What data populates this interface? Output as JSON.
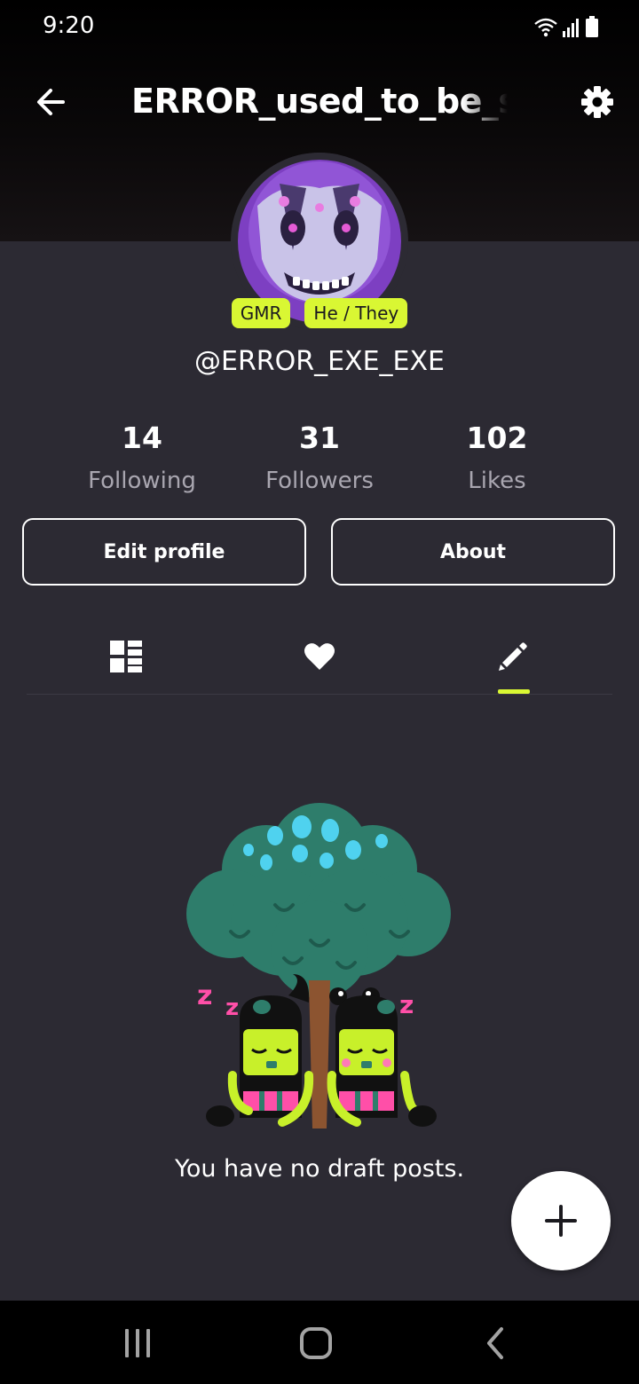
{
  "status_bar": {
    "time": "9:20",
    "icons": [
      "wifi-icon",
      "signal-icon",
      "battery-icon"
    ]
  },
  "header": {
    "title": "ERROR_used_to_be_san",
    "back_icon": "arrow-left-icon",
    "settings_icon": "gear-icon"
  },
  "profile": {
    "badges": [
      "GMR",
      "He / They"
    ],
    "username": "@ERROR_EXE_EXE",
    "stats": [
      {
        "value": "14",
        "label": "Following"
      },
      {
        "value": "31",
        "label": "Followers"
      },
      {
        "value": "102",
        "label": "Likes"
      }
    ]
  },
  "actions": {
    "edit_label": "Edit profile",
    "about_label": "About"
  },
  "tabs": [
    {
      "icon": "grid-icon",
      "active": false
    },
    {
      "icon": "heart-icon",
      "active": false
    },
    {
      "icon": "pencil-icon",
      "active": true
    }
  ],
  "empty_state": {
    "message": "You have no draft posts."
  },
  "fab": {
    "icon": "plus-icon"
  },
  "nav_bar": {
    "icons": [
      "recents-icon",
      "home-icon",
      "back-chevron-icon"
    ]
  },
  "colors": {
    "background": "#2c2a33",
    "accent": "#d9f733",
    "muted_text": "#a9a6b0"
  }
}
